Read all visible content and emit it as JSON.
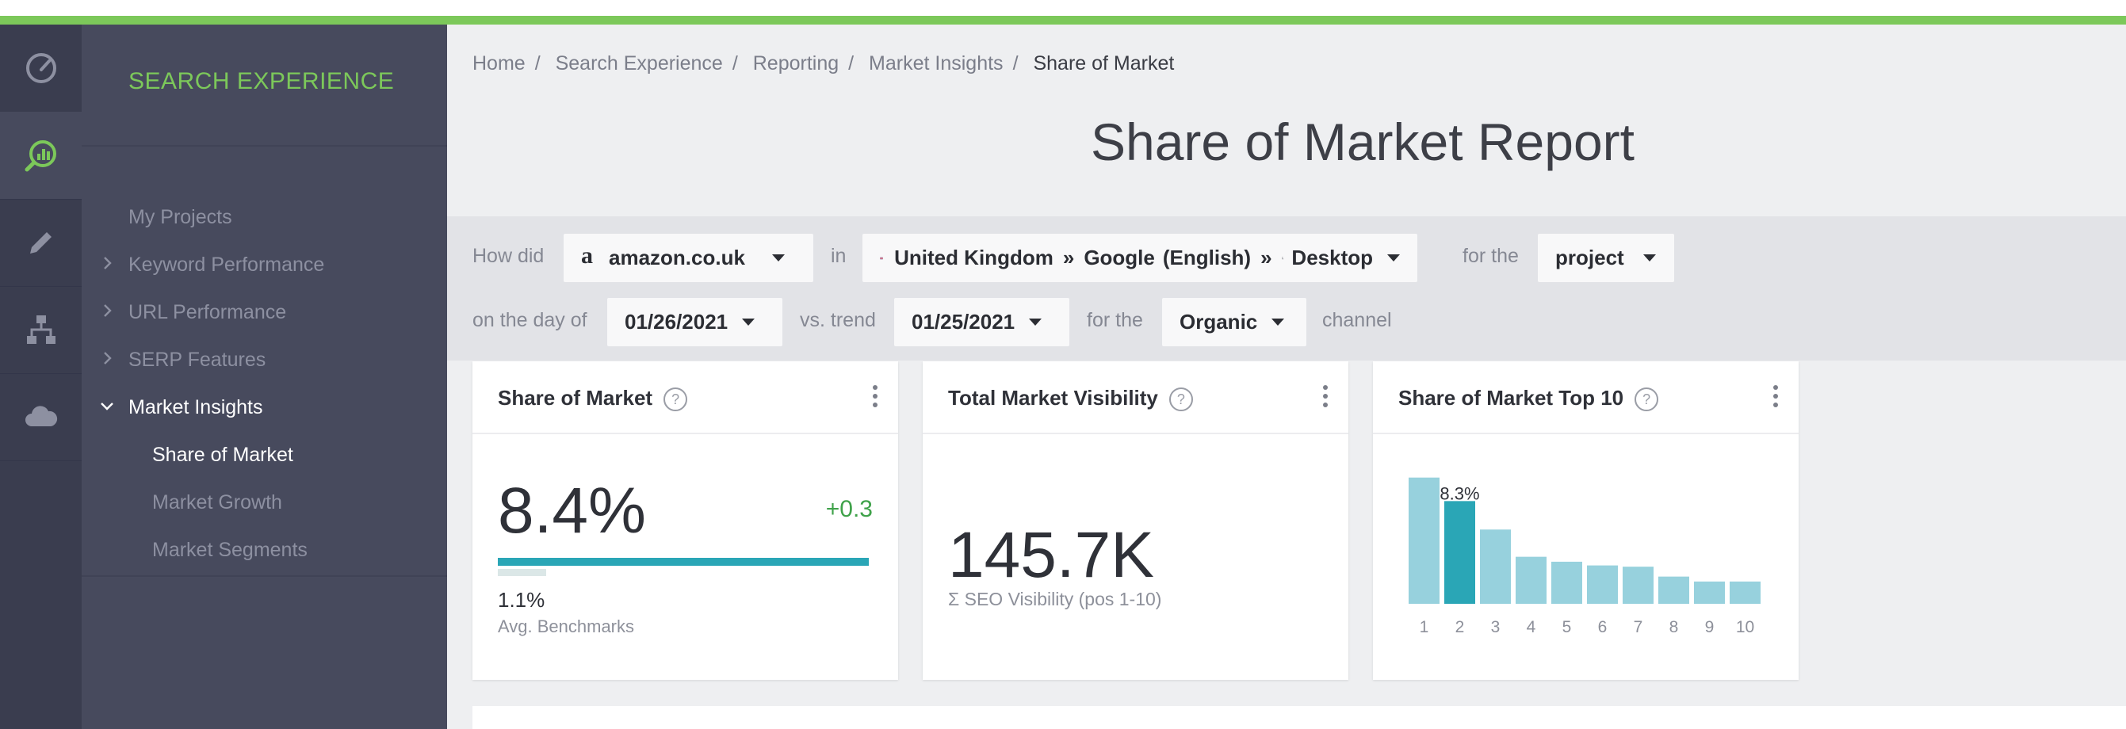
{
  "brand": "SEARCH EXPERIENCE",
  "colors": {
    "accent": "#7cc85a",
    "bar": "#2aa6b6",
    "bar_light": "#97d1dd",
    "positive": "#3fa24a"
  },
  "rail": [
    {
      "icon": "gauge-icon"
    },
    {
      "icon": "market-insights-icon"
    },
    {
      "icon": "pencil-icon"
    },
    {
      "icon": "sitemap-icon"
    },
    {
      "icon": "cloud-icon"
    }
  ],
  "sidebar": {
    "items": [
      {
        "label": "My Projects"
      },
      {
        "label": "Keyword Performance"
      },
      {
        "label": "URL Performance"
      },
      {
        "label": "SERP Features"
      },
      {
        "label": "Market Insights"
      }
    ],
    "sub_items": [
      {
        "label": "Share of Market"
      },
      {
        "label": "Market Growth"
      },
      {
        "label": "Market Segments"
      }
    ]
  },
  "breadcrumb": [
    "Home",
    "Search Experience",
    "Reporting",
    "Market Insights",
    "Share of Market"
  ],
  "page_title": "Share of Market Report",
  "filters": {
    "how_did": "How did",
    "domain": "amazon.co.uk",
    "domain_logo": "a",
    "in": "in",
    "country": "United Kingdom",
    "arrow1": "»",
    "engine": "Google",
    "language": "(English)",
    "arrow2": "»",
    "device": "Desktop",
    "for_the_1": "for the",
    "scope": "project",
    "on_the_day_of": "on the day of",
    "date": "01/26/2021",
    "vs_trend": "vs. trend",
    "trend_date": "01/25/2021",
    "for_the_2": "for the",
    "channel_type": "Organic",
    "channel": "channel"
  },
  "cards": {
    "share": {
      "title": "Share of Market",
      "value": "8.4%",
      "value_fraction": 0.084,
      "delta": "+0.3",
      "benchmark": "1.1%",
      "benchmark_fraction": 0.011,
      "benchmark_label": "Avg. Benchmarks"
    },
    "visibility": {
      "title": "Total Market Visibility",
      "value": "145.7K",
      "subtitle": "Σ SEO Visibility (pos 1-10)"
    },
    "top10": {
      "title": "Share of Market Top 10",
      "highlight_label": "8.3%"
    }
  },
  "chart_data": {
    "type": "bar",
    "categories": [
      "1",
      "2",
      "3",
      "4",
      "5",
      "6",
      "7",
      "8",
      "9",
      "10"
    ],
    "values": [
      10.2,
      8.3,
      6.0,
      3.8,
      3.4,
      3.1,
      3.0,
      2.2,
      1.8,
      1.8
    ],
    "highlight_index": 1,
    "highlight_label": "8.3%",
    "ylim": [
      0,
      10.5
    ],
    "grid": false
  }
}
